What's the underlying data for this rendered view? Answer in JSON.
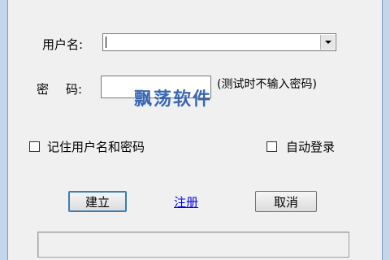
{
  "form": {
    "username_label": "用户名:",
    "username_value": "",
    "password_label_1": "密",
    "password_label_2": "码:",
    "password_value": "",
    "password_hint": "(测试时不输入密码)",
    "remember_label": "记住用户名和密码",
    "remember_checked": false,
    "autologin_label": "自动登录",
    "autologin_checked": false
  },
  "buttons": {
    "create_label": "建立",
    "register_link": "注册",
    "cancel_label": "取消"
  },
  "watermark": "飘荡软件"
}
